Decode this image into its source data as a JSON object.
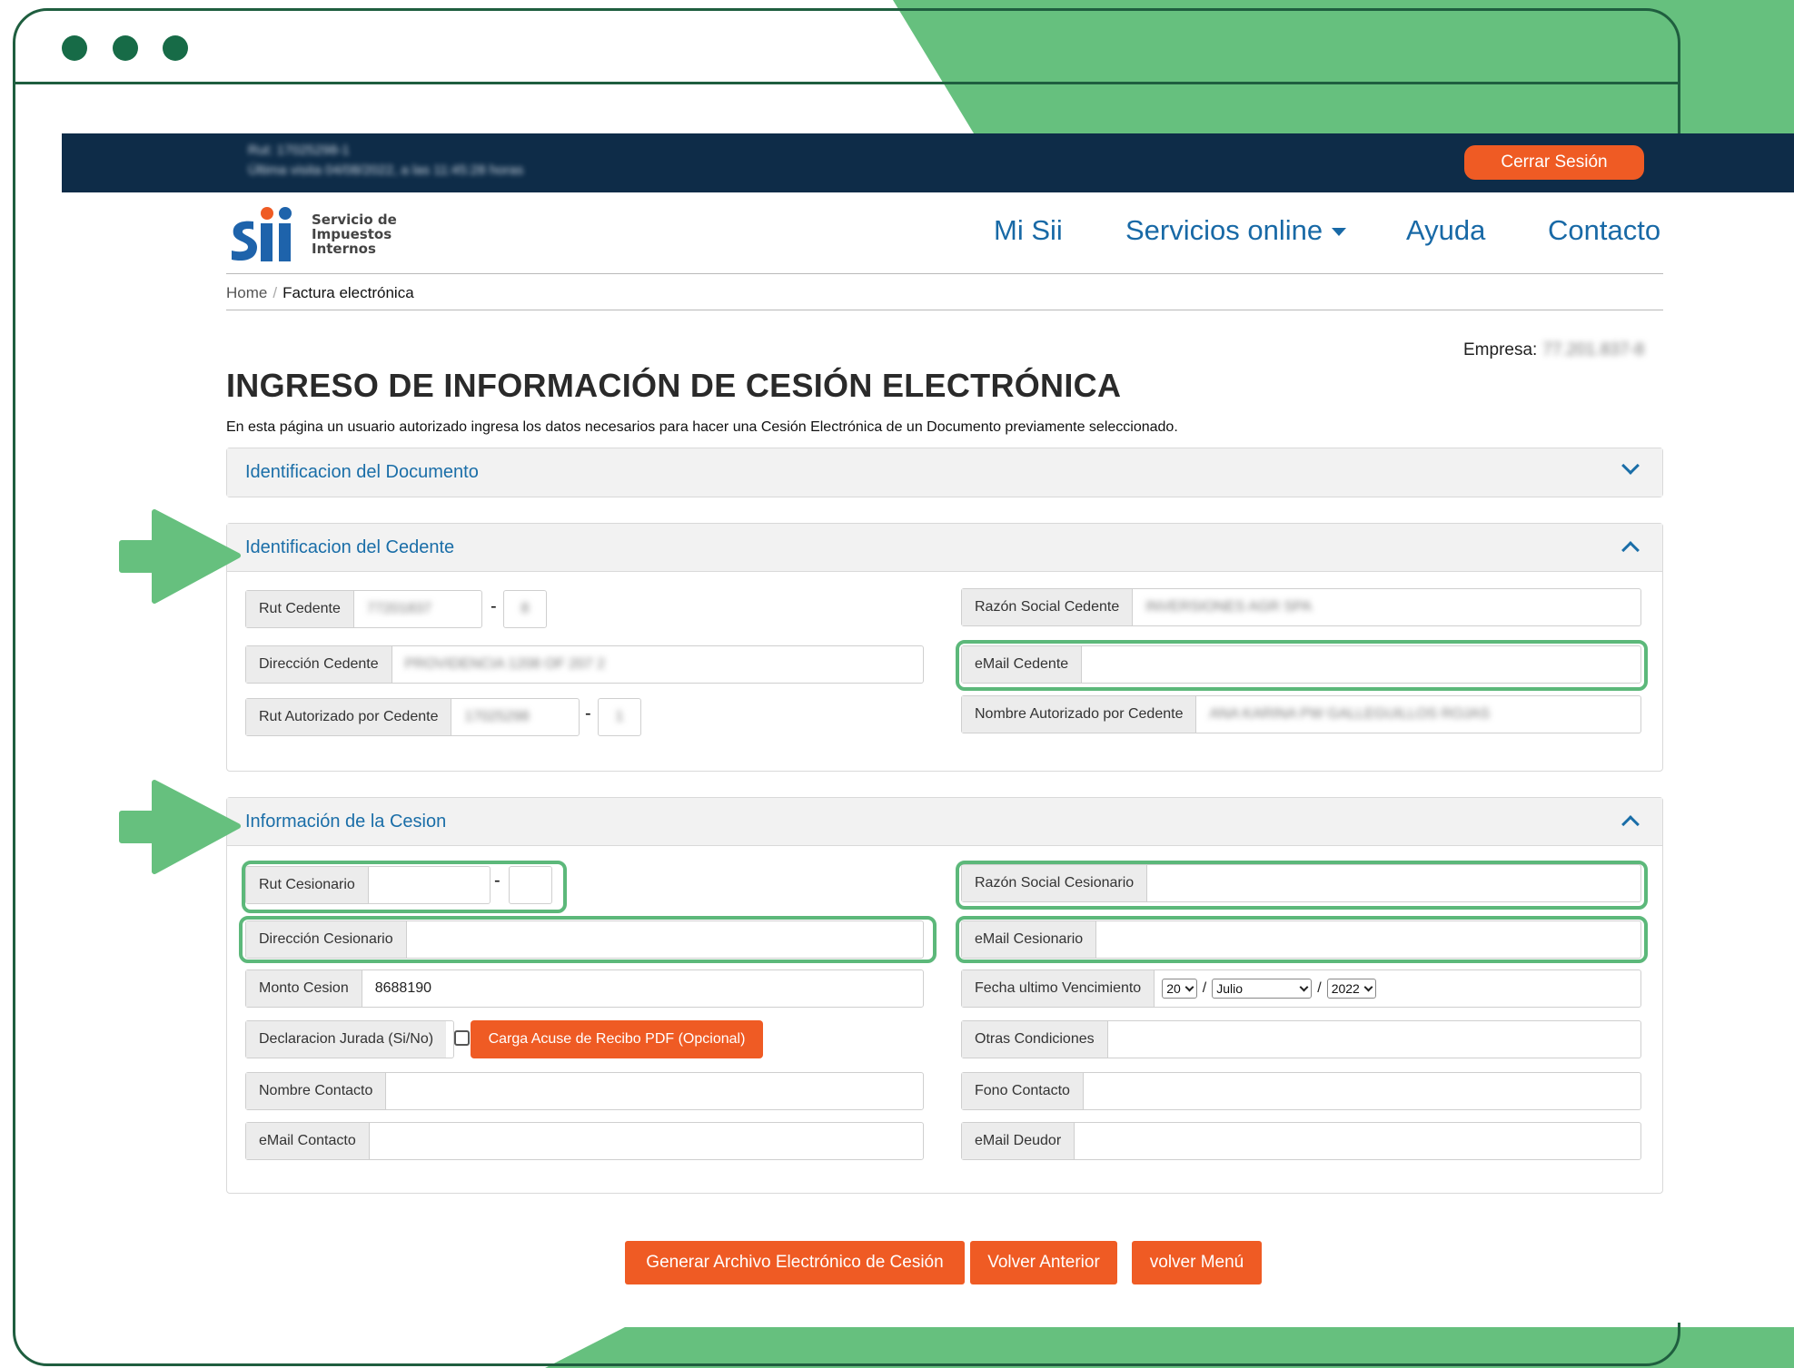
{
  "colors": {
    "brand_green": "#66c07e",
    "frame_green": "#1f5e3f",
    "topbar": "#0e2c48",
    "accent_orange": "#ef5b24",
    "link_blue": "#1a6ea8",
    "highlight": "#5cb87a"
  },
  "window": {
    "dots": [
      "dot",
      "dot",
      "dot"
    ]
  },
  "topbar": {
    "user_line1": "Rut: 17025298-1",
    "user_line2": "Última visita 04/08/2022, a las 11:45:28 horas",
    "logout_label": "Cerrar Sesión"
  },
  "logo": {
    "line1": "Servicio de",
    "line2": "Impuestos",
    "line3": "Internos"
  },
  "nav": {
    "mi_sii": "Mi Sii",
    "servicios": "Servicios online",
    "ayuda": "Ayuda",
    "contacto": "Contacto"
  },
  "breadcrumb": {
    "home": "Home",
    "sep": "/",
    "current": "Factura electrónica"
  },
  "empresa": {
    "label": "Empresa:",
    "value": "77.201.837-8"
  },
  "page": {
    "title": "INGRESO DE INFORMACIÓN DE CESIÓN ELECTRÓNICA",
    "subtitle": "En esta página un usuario autorizado ingresa los datos necesarios para hacer una Cesión Electrónica de un Documento previamente seleccionado."
  },
  "panels": {
    "documento": {
      "title": "Identificacion del Documento",
      "icon": "chevron-down-icon"
    },
    "cedente": {
      "title": "Identificacion del Cedente",
      "icon": "chevron-up-icon",
      "rut_label": "Rut Cedente",
      "rut_value": "77201837",
      "rut_dv": "8",
      "direccion_label": "Dirección Cedente",
      "direccion_value": "PROVIDENCIA 1208 OF 207 2",
      "rut_aut_label": "Rut Autorizado por Cedente",
      "rut_aut_value": "17025298",
      "rut_aut_dv": "1",
      "razon_label": "Razón Social Cedente",
      "razon_value": "INVERSIONES AGR SPA",
      "email_label": "eMail Cedente",
      "email_value": "",
      "nombre_aut_label": "Nombre Autorizado por Cedente",
      "nombre_aut_value": "ANA KARINA PW GALLEGUILLOS ROJAS"
    },
    "cesion": {
      "title": "Información de la Cesion",
      "icon": "chevron-up-icon",
      "rut_label": "Rut Cesionario",
      "rut_value": "",
      "rut_dv": "",
      "direccion_label": "Dirección Cesionario",
      "direccion_value": "",
      "monto_label": "Monto Cesion",
      "monto_value": "8688190",
      "declaracion_label": "Declaracion Jurada (Si/No)",
      "upload_label": "Carga Acuse de Recibo PDF (Opcional)",
      "nombre_contacto_label": "Nombre Contacto",
      "nombre_contacto_value": "",
      "email_contacto_label": "eMail Contacto",
      "email_contacto_value": "",
      "razon_label": "Razón Social Cesionario",
      "razon_value": "",
      "email_label": "eMail Cesionario",
      "email_value": "",
      "fecha_label": "Fecha ultimo Vencimiento",
      "fecha_day": "20",
      "fecha_month": "Julio",
      "fecha_year": "2022",
      "fecha_sep": "/",
      "otras_label": "Otras Condiciones",
      "otras_value": "",
      "fono_label": "Fono Contacto",
      "fono_value": "",
      "email_deudor_label": "eMail Deudor",
      "email_deudor_value": ""
    }
  },
  "actions": {
    "generar": "Generar Archivo Electrónico de Cesión",
    "volver_anterior": "Volver Anterior",
    "volver_menu": "volver Menú"
  }
}
